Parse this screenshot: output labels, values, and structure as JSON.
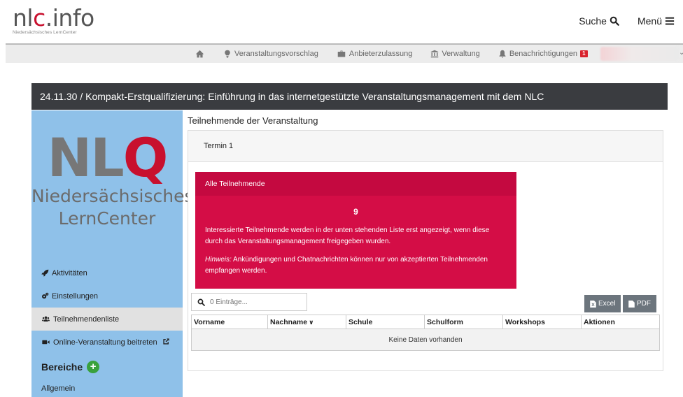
{
  "header": {
    "logo_prefix": "nl",
    "logo_accent": "c",
    "logo_suffix": ".info",
    "logo_sub": "Niedersächsisches LernCenter",
    "search_label": "Suche",
    "menu_label": "Menü"
  },
  "nav": {
    "items": [
      {
        "label": "",
        "icon": "home-icon"
      },
      {
        "label": "Veranstaltungsvorschlag",
        "icon": "lightbulb-icon"
      },
      {
        "label": "Anbieterzulassung",
        "icon": "briefcase-icon"
      },
      {
        "label": "Verwaltung",
        "icon": "bank-icon"
      },
      {
        "label": "Benachrichtigungen",
        "icon": "bell-icon"
      }
    ],
    "notification_count": "1"
  },
  "title": "24.11.30 / Kompakt-Erstqualifizierung: Einführung in das internetgestützte Veranstaltungsmanagement mit dem NLC",
  "sidebar": {
    "logo_n": "NL",
    "logo_q": "Q",
    "logo_line1": "Niedersächsisches",
    "logo_line2": "LernCenter",
    "items": [
      {
        "label": "Aktivitäten",
        "icon": "rocket-icon"
      },
      {
        "label": "Einstellungen",
        "icon": "gears-icon"
      },
      {
        "label": "Teilnehmendenliste",
        "icon": "users-icon"
      },
      {
        "label": "Online-Veranstaltung beitreten",
        "icon": "video-icon"
      }
    ],
    "bereiche_label": "Bereiche",
    "bereiche_first": "Allgemein"
  },
  "main": {
    "heading": "Teilnehmende der Veranstaltung",
    "tab": "Termin 1",
    "alert": {
      "head": "Alle Teilnehmende",
      "count": "9",
      "text": "Interessierte Teilnehmende werden in der unten stehenden Liste erst angezeigt, wenn diese durch das Veranstaltungsmanagement freigegeben wurden.",
      "hint_label": "Hinweis:",
      "hint": " Ankündigungen und Chatnachrichten können nur von akzeptierten Teilnehmenden empfangen werden."
    },
    "search_placeholder": "0 Einträge...",
    "excel_label": "Excel",
    "pdf_label": "PDF",
    "columns": [
      "Vorname",
      "Nachname",
      "Schule",
      "Schulform",
      "Workshops",
      "Aktionen"
    ],
    "empty_text": "Keine Daten vorhanden"
  },
  "colors": {
    "accent_red": "#c8102e",
    "alert_bg": "#d40d46",
    "sidebar_bg": "#8fc1e9",
    "title_bg": "#3a3c40"
  }
}
